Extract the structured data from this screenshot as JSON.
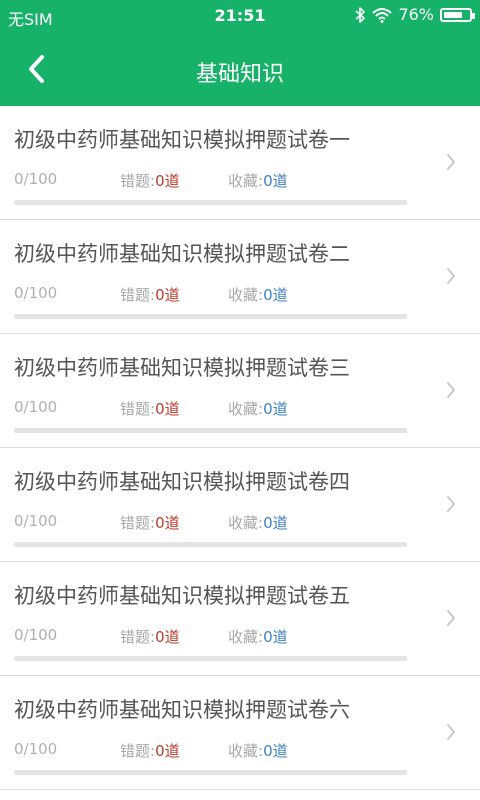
{
  "status_bar": {
    "carrier": "无SIM",
    "time": "21:51",
    "battery_text": "76%",
    "battery_level": 0.76
  },
  "nav": {
    "title": "基础知识"
  },
  "items": [
    {
      "title": "初级中药师基础知识模拟押题试卷一",
      "progress": "0/100",
      "wrong_label": "错题:",
      "wrong_value": "0道",
      "fav_label": "收藏:",
      "fav_value": "0道",
      "progress_fraction": 0
    },
    {
      "title": "初级中药师基础知识模拟押题试卷二",
      "progress": "0/100",
      "wrong_label": "错题:",
      "wrong_value": "0道",
      "fav_label": "收藏:",
      "fav_value": "0道",
      "progress_fraction": 0
    },
    {
      "title": "初级中药师基础知识模拟押题试卷三",
      "progress": "0/100",
      "wrong_label": "错题:",
      "wrong_value": "0道",
      "fav_label": "收藏:",
      "fav_value": "0道",
      "progress_fraction": 0
    },
    {
      "title": "初级中药师基础知识模拟押题试卷四",
      "progress": "0/100",
      "wrong_label": "错题:",
      "wrong_value": "0道",
      "fav_label": "收藏:",
      "fav_value": "0道",
      "progress_fraction": 0
    },
    {
      "title": "初级中药师基础知识模拟押题试卷五",
      "progress": "0/100",
      "wrong_label": "错题:",
      "wrong_value": "0道",
      "fav_label": "收藏:",
      "fav_value": "0道",
      "progress_fraction": 0
    },
    {
      "title": "初级中药师基础知识模拟押题试卷六",
      "progress": "0/100",
      "wrong_label": "错题:",
      "wrong_value": "0道",
      "fav_label": "收藏:",
      "fav_value": "0道",
      "progress_fraction": 0
    }
  ]
}
